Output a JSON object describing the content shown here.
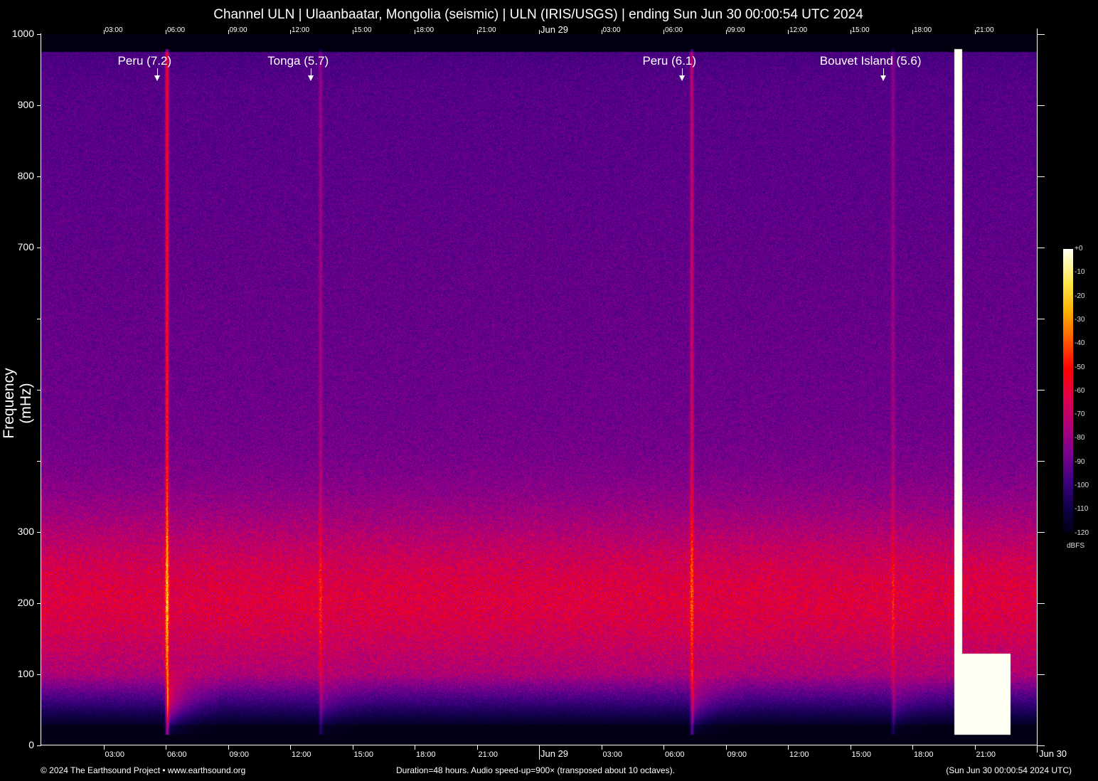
{
  "chart_data": {
    "type": "heatmap",
    "title": "Channel ULN | Ulaanbaatar, Mongolia (seismic) | ULN (IRIS/USGS) | ending Sun Jun 30 00:00:54 UTC 2024",
    "ylabel": "Frequency (mHz)",
    "ylim": [
      0,
      1000
    ],
    "y_ticks": [
      0,
      100,
      200,
      300,
      400,
      500,
      600,
      700,
      800,
      900,
      1000
    ],
    "y_tick_labels": [
      "0",
      "100",
      "200",
      "300",
      "",
      "",
      "",
      "700",
      "800",
      "900",
      "1000"
    ],
    "x_range_hours": [
      0,
      48
    ],
    "x_ticks": [
      {
        "h": 3,
        "label": "03:00"
      },
      {
        "h": 6,
        "label": "06:00"
      },
      {
        "h": 9,
        "label": "09:00"
      },
      {
        "h": 12,
        "label": "12:00"
      },
      {
        "h": 15,
        "label": "15:00"
      },
      {
        "h": 18,
        "label": "18:00"
      },
      {
        "h": 21,
        "label": "21:00"
      },
      {
        "h": 24,
        "label": "Jun 29"
      },
      {
        "h": 27,
        "label": "03:00"
      },
      {
        "h": 30,
        "label": "06:00"
      },
      {
        "h": 33,
        "label": "09:00"
      },
      {
        "h": 36,
        "label": "12:00"
      },
      {
        "h": 39,
        "label": "15:00"
      },
      {
        "h": 42,
        "label": "18:00"
      },
      {
        "h": 45,
        "label": "21:00"
      }
    ],
    "x_end_label": "Jun 30",
    "events": [
      {
        "label": "Peru (7.2)",
        "h": 5.6,
        "strength": 1.0
      },
      {
        "label": "Tonga (5.7)",
        "h": 13.0,
        "strength": 0.35
      },
      {
        "label": "Peru (6.1)",
        "h": 30.9,
        "strength": 0.6
      },
      {
        "label": "Bouvet Island (5.6)",
        "h": 40.6,
        "strength": 0.3
      }
    ],
    "unlabeled_signals": [
      {
        "h": 44.2,
        "strength": 0.55
      }
    ],
    "colorbar": {
      "unit": "dBFS",
      "range": [
        -120,
        0
      ],
      "labels": [
        "+0",
        "-10",
        "-20",
        "-30",
        "-40",
        "-50",
        "-60",
        "-70",
        "-80",
        "-90",
        "-100",
        "-110",
        "-120"
      ]
    }
  },
  "footer": {
    "copyright": "© 2024 The Earthsound Project • www.earthsound.org",
    "info": "Duration=48 hours. Audio speed-up=900× (transposed about 10 octaves).",
    "end_time": "(Sun Jun 30 00:00:54 2024 UTC)"
  }
}
